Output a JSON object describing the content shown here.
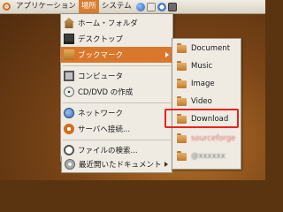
{
  "top_panel": {
    "menus": [
      {
        "label": "アプリケーション"
      },
      {
        "label": "場所"
      },
      {
        "label": "システム"
      }
    ],
    "icons": [
      "firefox-icon",
      "mail-icon",
      "help-icon",
      "screenshot-icon"
    ]
  },
  "places_menu": {
    "items": [
      {
        "label": "ホーム・フォルダ",
        "icon": "home-folder-icon"
      },
      {
        "label": "デスクトップ",
        "icon": "desktop-icon"
      },
      {
        "label": "ブックマーク",
        "icon": "bookmark-folder-icon",
        "submenu": true,
        "highlighted": true
      },
      {
        "label": "コンピュータ",
        "icon": "computer-icon"
      },
      {
        "label": "CD/DVD の作成",
        "icon": "cd-icon"
      },
      {
        "label": "ネットワーク",
        "icon": "network-icon"
      },
      {
        "label": "サーバへ接続...",
        "icon": "server-icon"
      },
      {
        "label": "ファイルの検索...",
        "icon": "search-icon"
      },
      {
        "label": "最近開いたドキュメント",
        "icon": "recent-icon",
        "submenu": true
      }
    ]
  },
  "bookmark_submenu": {
    "items": [
      {
        "label": "Document"
      },
      {
        "label": "Music"
      },
      {
        "label": "Image"
      },
      {
        "label": "Video"
      },
      {
        "label": "Download"
      },
      {
        "label": "sourceforge"
      },
      {
        "label": "@xxxxxx"
      }
    ]
  },
  "colors": {
    "highlight": "#d9782c",
    "callout_box": "#e8231c"
  }
}
